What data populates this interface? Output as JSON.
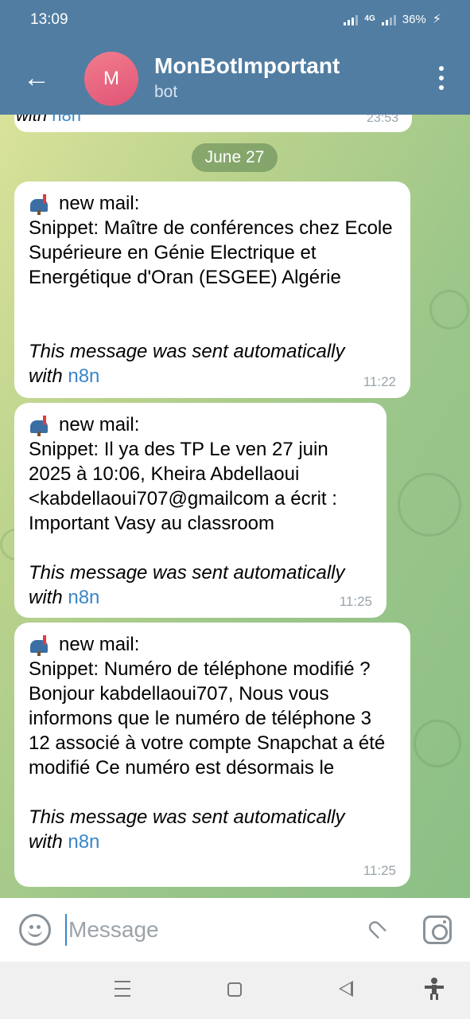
{
  "status_bar": {
    "time": "13:09",
    "network": "4G",
    "battery": "36%"
  },
  "header": {
    "avatar_letter": "M",
    "title": "MonBotImportant",
    "subtitle": "bot"
  },
  "previous_message": {
    "footer_tail_prefix": "with ",
    "link": "n8n",
    "time": "23:53"
  },
  "date_separator": "June 27",
  "messages": [
    {
      "heading": "new mail:",
      "snippet": "Snippet: Maître de conférences chez Ecole Supérieure en Génie Electrique et Energétique d'Oran (ESGEE) Algérie",
      "footer": "This message was sent automatically",
      "footer_tail_prefix": "with ",
      "link": "n8n",
      "time": "11:22"
    },
    {
      "heading": "new mail:",
      "snippet": "Snippet: Il ya des TP Le ven 27 juin 2025 à 10:06, Kheira Abdellaoui <kabdellaoui707@gmailcom a écrit : Important Vasy au classroom",
      "footer": "This message was sent automatically",
      "footer_tail_prefix": "with ",
      "link": "n8n",
      "time": "11:25"
    },
    {
      "heading": "new mail:",
      "snippet": "Snippet: Numéro de téléphone modifié ? Bonjour kabdellaoui707, Nous vous informons que le numéro de téléphone 3 12 associé à votre compte Snapchat a été modifié Ce numéro est désormais le",
      "footer": "This message was sent automatically",
      "footer_tail_prefix": "with ",
      "link": "n8n",
      "time": "11:25"
    }
  ],
  "composer": {
    "placeholder": "Message"
  },
  "icons": {
    "back": "arrow-left-icon",
    "menu": "more-vertical-icon",
    "emoji": "emoji-icon",
    "attach": "paperclip-icon",
    "camera": "camera-icon",
    "mailbox": "mailbox-icon"
  }
}
